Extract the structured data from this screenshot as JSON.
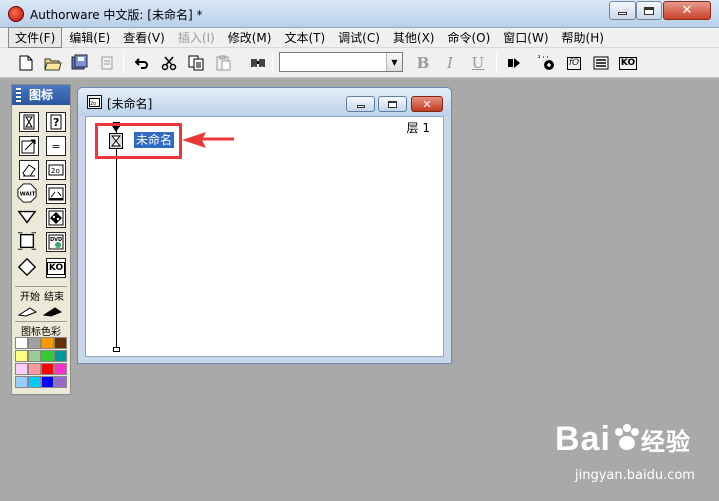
{
  "window": {
    "title": "Authorware 中文版: [未命名] *",
    "controls": {
      "minimize": "minimize",
      "maximize": "maximize",
      "close": "✕"
    }
  },
  "menu": [
    {
      "label": "文件(F)",
      "state": "active"
    },
    {
      "label": "编辑(E)",
      "state": "normal"
    },
    {
      "label": "查看(V)",
      "state": "normal"
    },
    {
      "label": "插入(I)",
      "state": "disabled"
    },
    {
      "label": "修改(M)",
      "state": "normal"
    },
    {
      "label": "文本(T)",
      "state": "normal"
    },
    {
      "label": "调试(C)",
      "state": "normal"
    },
    {
      "label": "其他(X)",
      "state": "normal"
    },
    {
      "label": "命令(O)",
      "state": "normal"
    },
    {
      "label": "窗口(W)",
      "state": "normal"
    },
    {
      "label": "帮助(H)",
      "state": "normal"
    }
  ],
  "toolbar": {
    "icons": [
      "new-file-icon",
      "open-folder-icon",
      "save-all-icon",
      "import-icon",
      "undo-icon",
      "cut-icon",
      "copy-icon",
      "paste-icon",
      "find-icon"
    ],
    "font_select_value": "",
    "bold": "B",
    "italic": "I",
    "underline": "U",
    "right_icons": [
      "run-icon",
      "control-panel-icon",
      "functions-icon",
      "variables-icon",
      "knowledge-objects-icon"
    ],
    "functions_label": "fO",
    "ko_label": "KO"
  },
  "palette": {
    "title": "图标",
    "start_label": "开始",
    "end_label": "结束",
    "colors_label": "图标色彩",
    "icon_texts": {
      "wait": "WAIT",
      "dvd": "DVD",
      "ko": "KO",
      "calc": "="
    },
    "colors": [
      "#ffffff",
      "#a0a0a0",
      "#ff9900",
      "#663300",
      "#ffff80",
      "#99cc99",
      "#33cc33",
      "#009999",
      "#ffccff",
      "#ff9999",
      "#ff0000",
      "#ff33cc",
      "#99ccff",
      "#00ccff",
      "#0000ff",
      "#9966cc"
    ]
  },
  "document": {
    "title": "[未命名]",
    "layer_label": "层 1",
    "map_icon_label": "未命名"
  },
  "watermark": {
    "brand": "Bai",
    "brand_cn": "经验",
    "url": "jingyan.baidu.com"
  }
}
